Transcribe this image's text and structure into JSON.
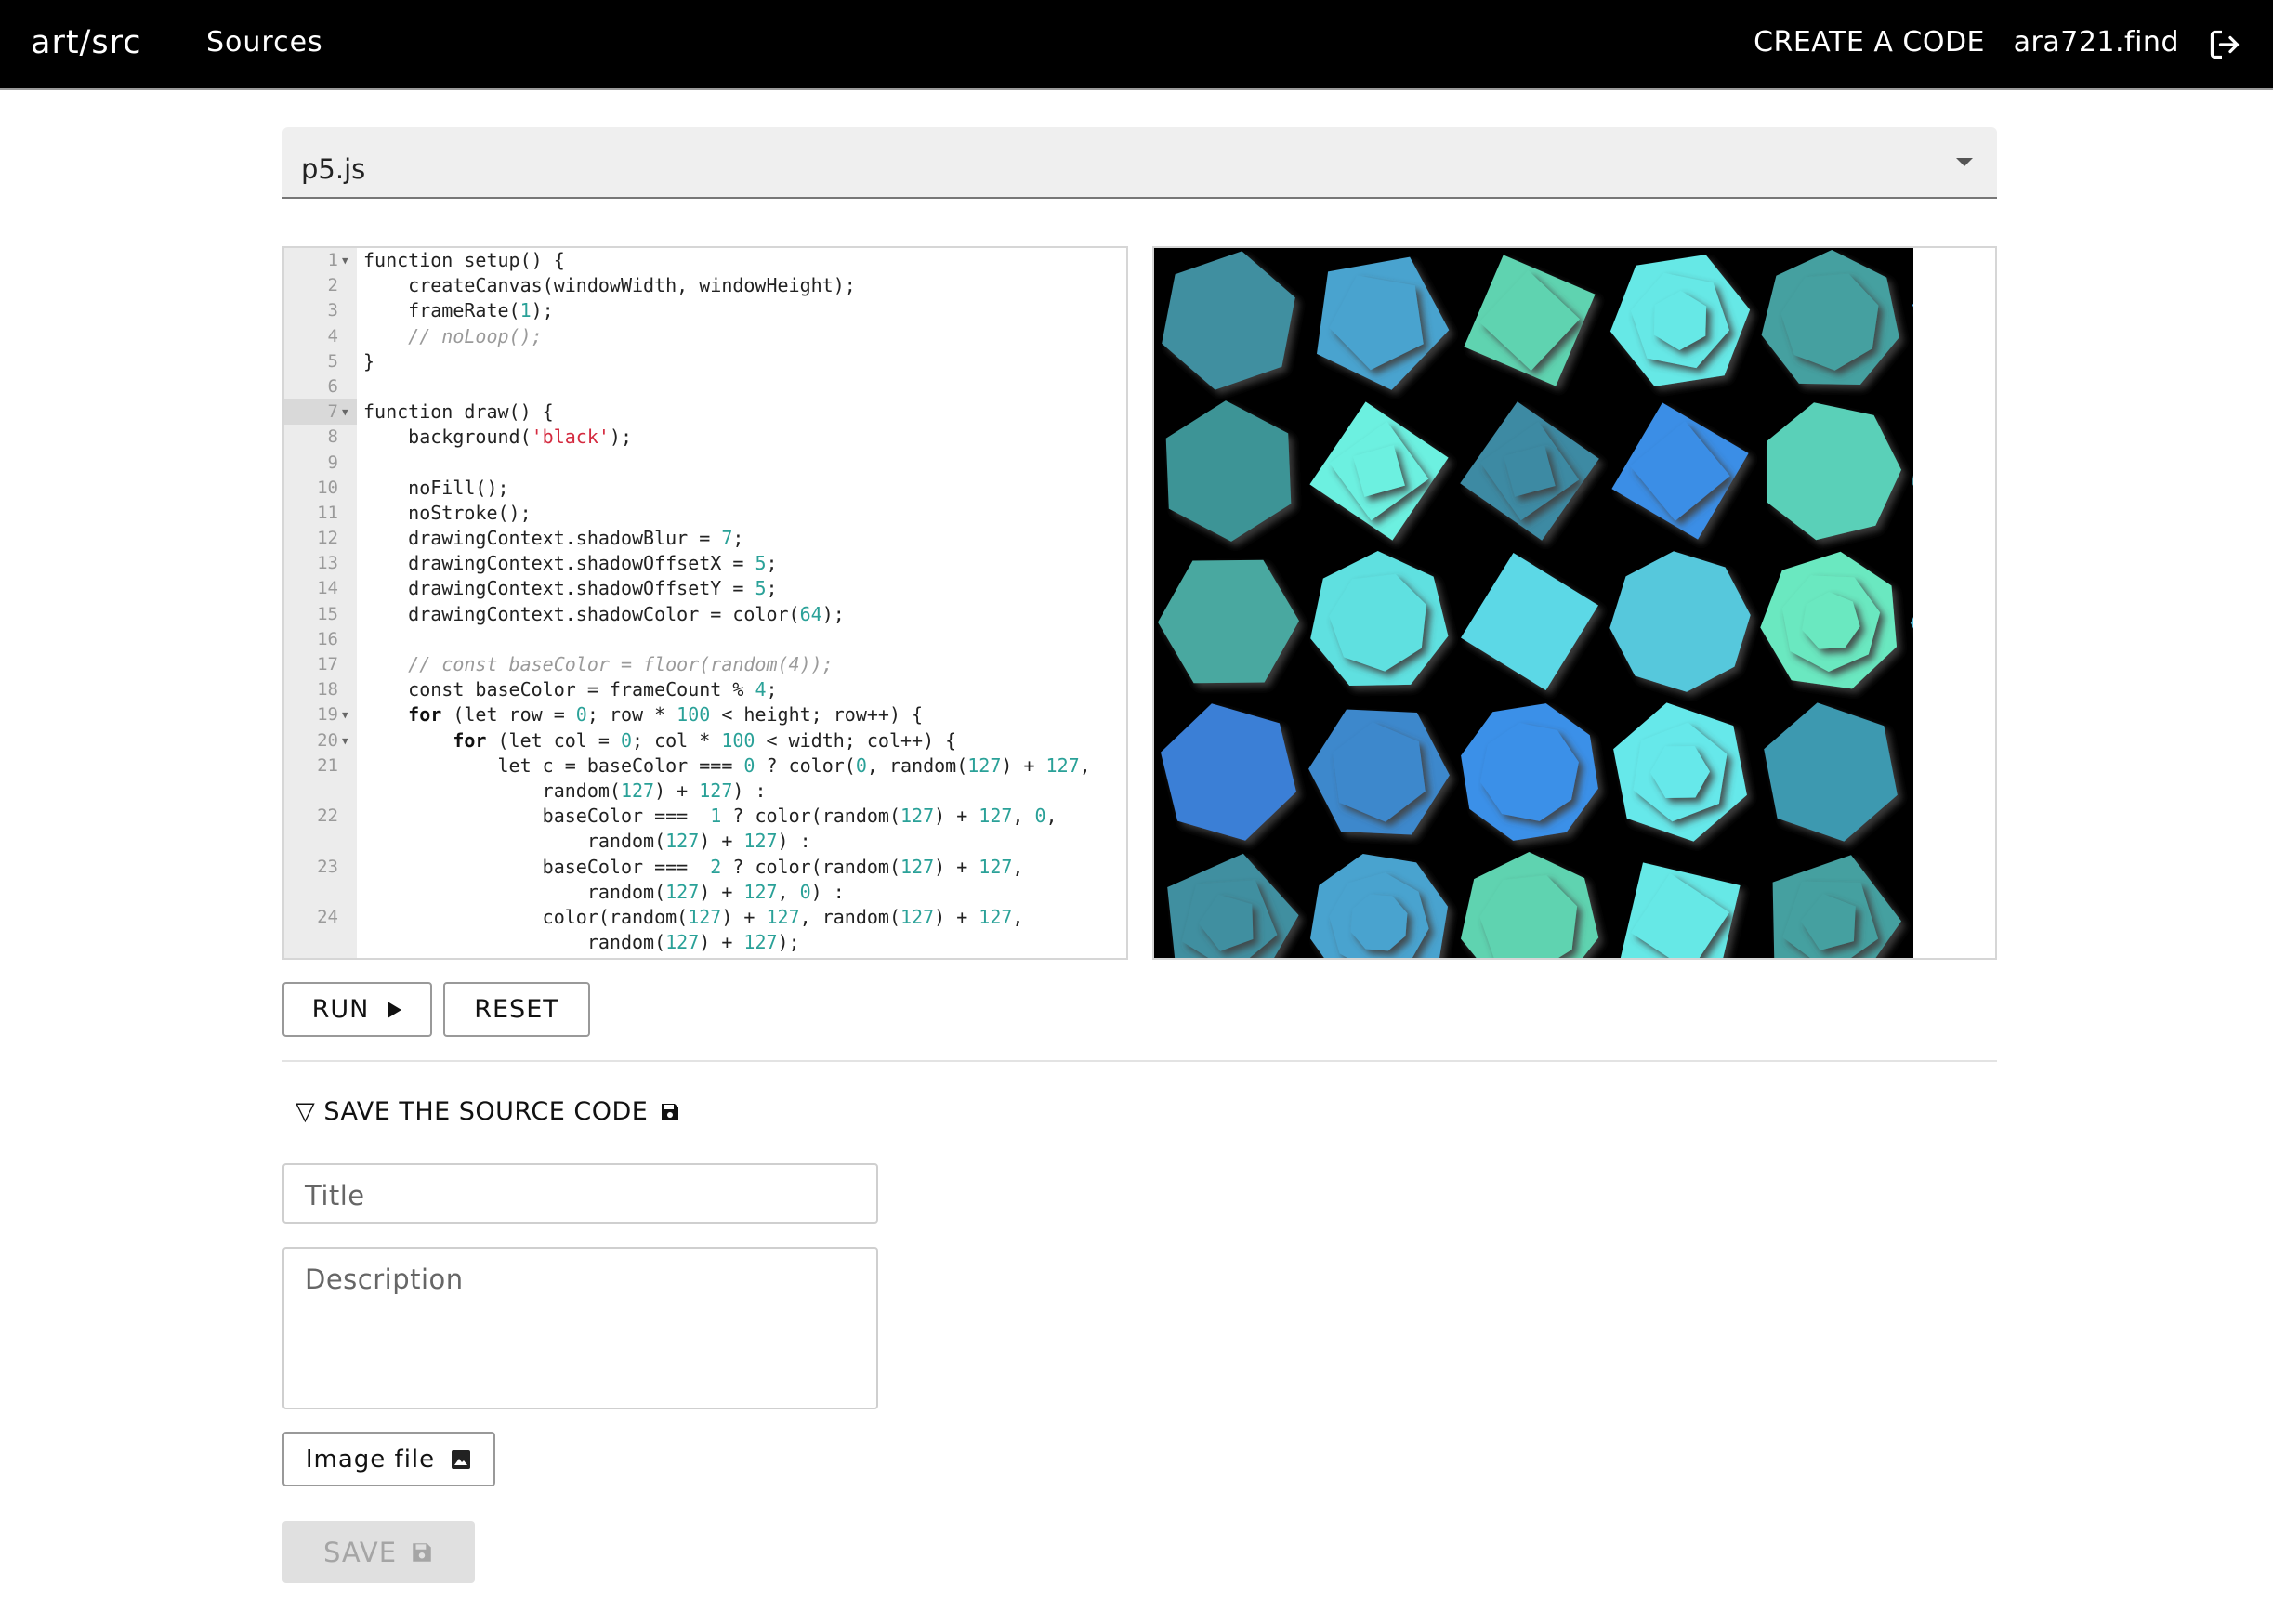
{
  "header": {
    "brand": "art/src",
    "nav_sources": "Sources",
    "nav_create": "CREATE A CODE",
    "user": "ara721.find",
    "logout_icon": "logout-icon"
  },
  "library_select": {
    "value": "p5.js"
  },
  "editor": {
    "lines": [
      {
        "n": "1",
        "fold": true,
        "html": "function setup() {"
      },
      {
        "n": "2",
        "html": "    createCanvas(windowWidth, windowHeight);"
      },
      {
        "n": "3",
        "html": "    frameRate(1);"
      },
      {
        "n": "4",
        "html": "    // noLoop();"
      },
      {
        "n": "5",
        "html": "}"
      },
      {
        "n": "6",
        "html": ""
      },
      {
        "n": "7",
        "fold": true,
        "active": true,
        "html": "function draw() {"
      },
      {
        "n": "8",
        "html": "    background('black');"
      },
      {
        "n": "9",
        "html": ""
      },
      {
        "n": "10",
        "html": "    noFill();"
      },
      {
        "n": "11",
        "html": "    noStroke();"
      },
      {
        "n": "12",
        "html": "    drawingContext.shadowBlur = 7;"
      },
      {
        "n": "13",
        "html": "    drawingContext.shadowOffsetX = 5;"
      },
      {
        "n": "14",
        "html": "    drawingContext.shadowOffsetY = 5;"
      },
      {
        "n": "15",
        "html": "    drawingContext.shadowColor = color(64);"
      },
      {
        "n": "16",
        "html": ""
      },
      {
        "n": "17",
        "html": "    // const baseColor = floor(random(4));"
      },
      {
        "n": "18",
        "html": "    const baseColor = frameCount % 4;"
      },
      {
        "n": "19",
        "fold": true,
        "html": "    for (let row = 0; row * 100 < height; row++) {"
      },
      {
        "n": "20",
        "fold": true,
        "html": "        for (let col = 0; col * 100 < width; col++) {"
      },
      {
        "n": "21",
        "html": "            let c = baseColor === 0 ? color(0, random(127) + 127,"
      },
      {
        "n": "",
        "html": "                random(127) + 127) :"
      },
      {
        "n": "22",
        "html": "                baseColor ===  1 ? color(random(127) + 127, 0,"
      },
      {
        "n": "",
        "html": "                    random(127) + 127) :"
      },
      {
        "n": "23",
        "html": "                baseColor ===  2 ? color(random(127) + 127,"
      },
      {
        "n": "",
        "html": "                    random(127) + 127, 0) :"
      },
      {
        "n": "24",
        "html": "                color(random(127) + 127, random(127) + 127,"
      },
      {
        "n": "",
        "html": "                    random(127) + 127);"
      }
    ]
  },
  "canvas": {
    "background": "#000000",
    "colors": [
      "#3f8fa0",
      "#4aa3cf",
      "#5fd3b0",
      "#66e8e6",
      "#45a0a0",
      "#4aaef5",
      "#3e9496",
      "#6cf0e0",
      "#3d8aa3",
      "#3a8ee6",
      "#5ad0b8",
      "#3f8a96",
      "#4aa8a0",
      "#5fe0e0",
      "#5cd8e6",
      "#56c8dc",
      "#6ae8c0",
      "#58bcd8",
      "#3a7fd6",
      "#3c88cc",
      "#3b90e8",
      "#66e8ea",
      "#3d99b0",
      "#46a89e"
    ]
  },
  "buttons": {
    "run": "RUN",
    "reset": "RESET",
    "image_file": "Image file",
    "save": "SAVE"
  },
  "save_section": {
    "toggle_label": "▽ SAVE THE SOURCE CODE",
    "title_placeholder": "Title",
    "description_placeholder": "Description"
  }
}
